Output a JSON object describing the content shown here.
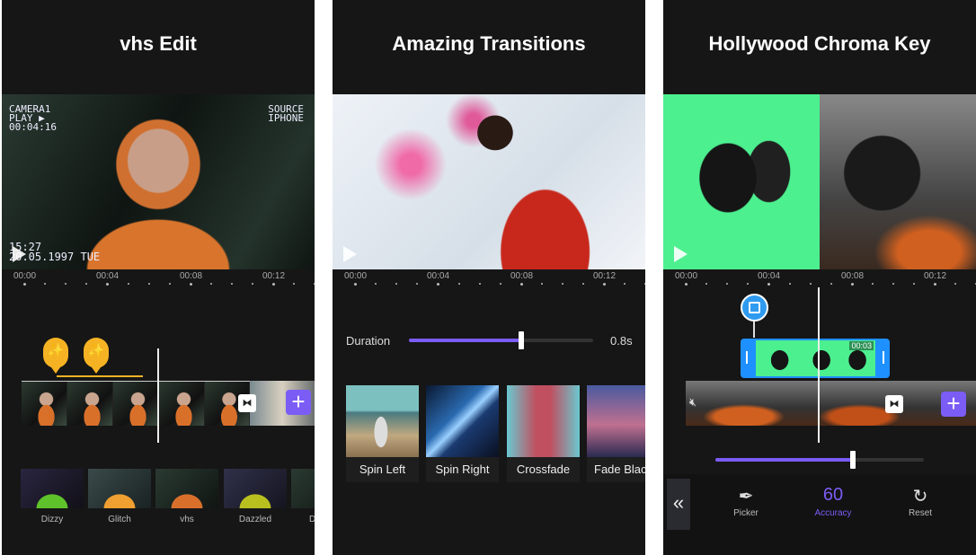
{
  "panels": [
    {
      "title": "vhs Edit",
      "overlay": {
        "top_left": [
          "CAMERA1",
          "PLAY ▶",
          "00:04:16"
        ],
        "top_right": [
          "SOURCE",
          "IPHONE"
        ],
        "time": "15:27",
        "date": "20.05.1997 TUE"
      },
      "ruler": [
        "00:00",
        "00:04",
        "00:08",
        "00:12"
      ],
      "transition_icon": "bowtie-icon",
      "add_label": "+",
      "filters": [
        "Dizzy",
        "Glitch",
        "vhs",
        "Dazzled",
        "D"
      ]
    },
    {
      "title": "Amazing Transitions",
      "ruler": [
        "00:00",
        "00:04",
        "00:08",
        "00:12"
      ],
      "duration": {
        "label": "Duration",
        "value": "0.8s",
        "fill_percent": 61
      },
      "transitions": [
        "Spin Left",
        "Spin Right",
        "Crossfade",
        "Fade Black"
      ]
    },
    {
      "title": "Hollywood Chroma Key",
      "ruler": [
        "00:00",
        "00:04",
        "00:08",
        "00:12"
      ],
      "clip_time": "00:03",
      "add_label": "+",
      "slider_percent": 66,
      "tools": [
        {
          "icon": "eyedropper-icon",
          "glyph": "✒",
          "label": "Picker"
        },
        {
          "icon": "",
          "glyph": "60",
          "label": "Accuracy",
          "active": true
        },
        {
          "icon": "reset-icon",
          "glyph": "↻",
          "label": "Reset"
        }
      ],
      "back_glyph": "«"
    }
  ],
  "colors": {
    "accent": "#7b5cf5",
    "sticker": "#f5b324",
    "chroma": "#4cf08f",
    "clip_select": "#1e90ff",
    "background": "#161616"
  }
}
